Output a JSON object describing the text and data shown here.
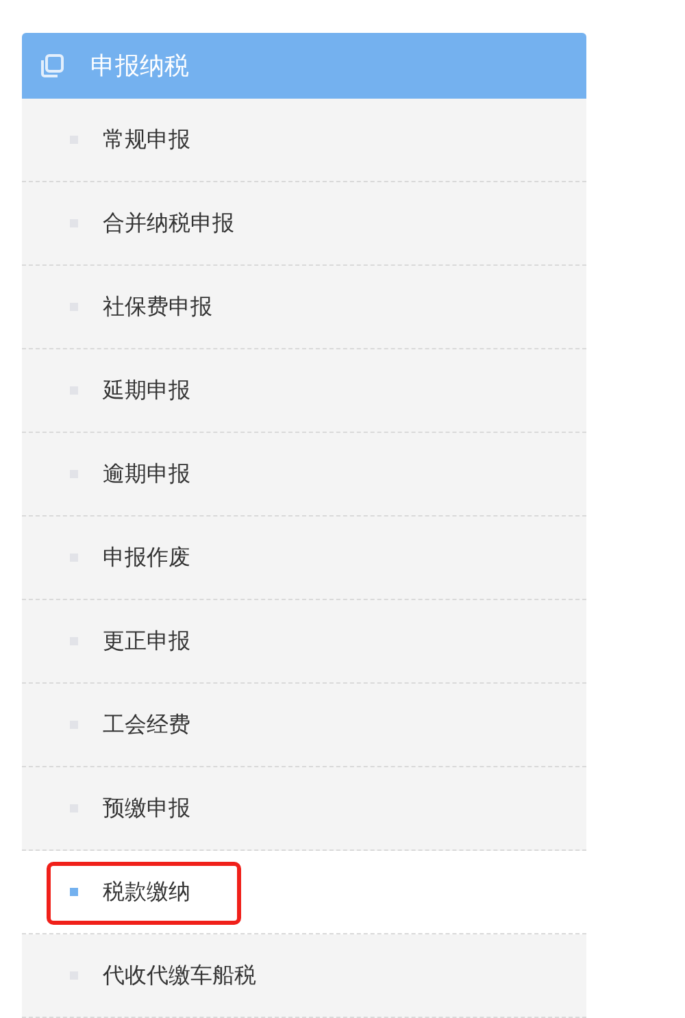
{
  "menu": {
    "title": "申报纳税",
    "items": [
      {
        "label": "常规申报",
        "selected": false,
        "highlighted": false
      },
      {
        "label": "合并纳税申报",
        "selected": false,
        "highlighted": false
      },
      {
        "label": "社保费申报",
        "selected": false,
        "highlighted": false
      },
      {
        "label": "延期申报",
        "selected": false,
        "highlighted": false
      },
      {
        "label": "逾期申报",
        "selected": false,
        "highlighted": false
      },
      {
        "label": "申报作废",
        "selected": false,
        "highlighted": false
      },
      {
        "label": "更正申报",
        "selected": false,
        "highlighted": false
      },
      {
        "label": "工会经费",
        "selected": false,
        "highlighted": false
      },
      {
        "label": "预缴申报",
        "selected": false,
        "highlighted": false
      },
      {
        "label": "税款缴纳",
        "selected": true,
        "highlighted": true
      },
      {
        "label": "代收代缴车船税",
        "selected": false,
        "highlighted": false
      }
    ]
  }
}
